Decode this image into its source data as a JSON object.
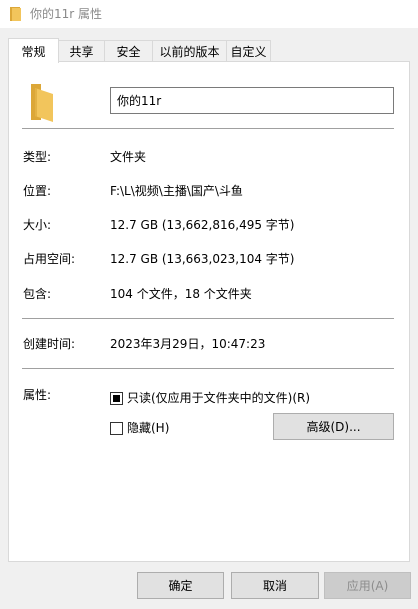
{
  "window": {
    "title": "你的11r 属性"
  },
  "tabs": [
    {
      "label": "常规"
    },
    {
      "label": "共享"
    },
    {
      "label": "安全"
    },
    {
      "label": "以前的版本"
    },
    {
      "label": "自定义"
    }
  ],
  "general": {
    "name_value": "你的11r",
    "type_label": "类型:",
    "type_value": "文件夹",
    "location_label": "位置:",
    "location_value": "F:\\L\\视频\\主播\\国产\\斗鱼",
    "size_label": "大小:",
    "size_value": "12.7 GB (13,662,816,495 字节)",
    "disk_label": "占用空间:",
    "disk_value": "12.7 GB (13,663,023,104 字节)",
    "contains_label": "包含:",
    "contains_value": "104 个文件，18 个文件夹",
    "created_label": "创建时间:",
    "created_value": "2023年3月29日，10:47:23",
    "attributes_label": "属性:",
    "readonly_label": "只读(仅应用于文件夹中的文件)(R)",
    "readonly_checked": true,
    "hidden_label": "隐藏(H)",
    "hidden_checked": false,
    "advanced_label": "高级(D)..."
  },
  "buttons": {
    "ok": "确定",
    "cancel": "取消",
    "apply": "应用(A)"
  },
  "colors": {
    "folder": "#f2c55c",
    "folder_dark": "#dca738"
  }
}
